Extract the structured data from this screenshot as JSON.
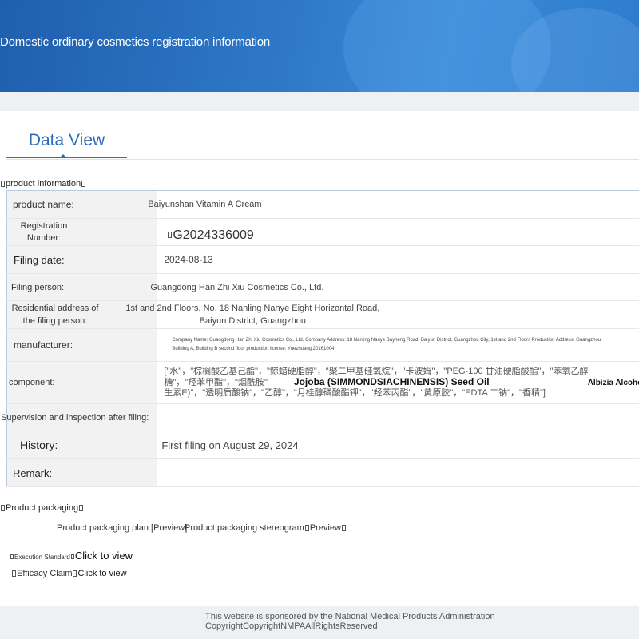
{
  "header": {
    "title": "Domestic ordinary cosmetics registration information"
  },
  "tab": {
    "label": "Data View"
  },
  "sections": {
    "product_info": "product information",
    "product_packaging": "Product packaging"
  },
  "fields": [
    {
      "label": "product name:",
      "value": "Baiyunshan Vitamin A Cream"
    },
    {
      "label": "Registration Number:",
      "value": "G2024336009"
    },
    {
      "label": "Filing date:",
      "value": "2024-08-13"
    },
    {
      "label": "Filing person:",
      "value": "Guangdong Han Zhi Xiu Cosmetics Co., Ltd."
    },
    {
      "label": "Residential address of the filing person:",
      "value": "1st and 2nd Floors, No. 18 Nanling Nanye Eight Horizontal Road, Baiyun District, Guangzhou"
    },
    {
      "label": "manufacturer:",
      "value": "Company Name: Guangdong Han Zhi Xiu Cosmetics Co., Ltd. Company Address: 18 Nanling Nanye Bayheng Road, Baiyun District, Guangzhou City, 1st and 2nd Floors Production Address: Guangzhou Building A, Building B second floor production license: Yuezhuang 20161004"
    },
    {
      "label": "component:",
      "value_line1": "[\"水\"，\"棕榈酸乙基己酯\"，\"鲸蜡硬脂醇\"，\"聚二甲基硅氧烷\"，\"卡波姆\"，\"PEG-100 甘油硬脂酸酯\"，\"苯氧乙醇",
      "value_line2": "糖\"，\"羟苯甲酯\"，\"烟酰胺\"",
      "value_line3": "生素E)\"，\"透明质酸钠\"，\"乙醇\"，\"月桂醇磷酸酯钾\"，\"羟苯丙酯\"，\"黄原胶\"，\"EDTA 二钠\"，\"香精\"]",
      "highlight1": "Jojoba (SIMMONDSIACHINENSIS) Seed Oil",
      "highlight2": "Albizia Alcohol"
    },
    {
      "label": "Supervision and inspection after filing:",
      "value": ""
    },
    {
      "label": "History:",
      "value": "First filing on August 29, 2024"
    },
    {
      "label": "Remark:",
      "value": ""
    }
  ],
  "packaging": {
    "plan": "Product packaging plan [Preview]",
    "stereogram": "Product packaging stereogram",
    "stereogram_link": "Preview"
  },
  "standards": {
    "execution_label": "Execution Standard",
    "execution_link": "Click to view",
    "efficacy_label": "Efficacy Claim",
    "efficacy_link": "Click to view"
  },
  "footer": {
    "text": "This website is sponsored by the National Medical Products Administration CopyrightCopyrightNMPAAllRightsReserved"
  },
  "colors": {
    "banner": "#2f78c8",
    "accent": "#2a6db8",
    "label_bg": "#f2f2f2"
  }
}
